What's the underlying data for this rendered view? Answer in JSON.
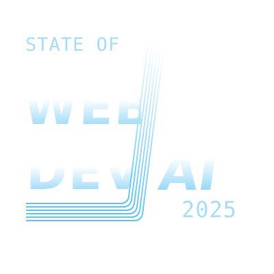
{
  "logo": {
    "prefix": "STATE OF",
    "word_one": "WEB",
    "word_two": "DEV",
    "word_three": "AI",
    "year": "2025"
  },
  "colors": {
    "text_light": "#a7dcf7",
    "gradient_top": "#ffffff",
    "gradient_bottom": "#78cdf5",
    "track_line": "#5cc3f2"
  }
}
